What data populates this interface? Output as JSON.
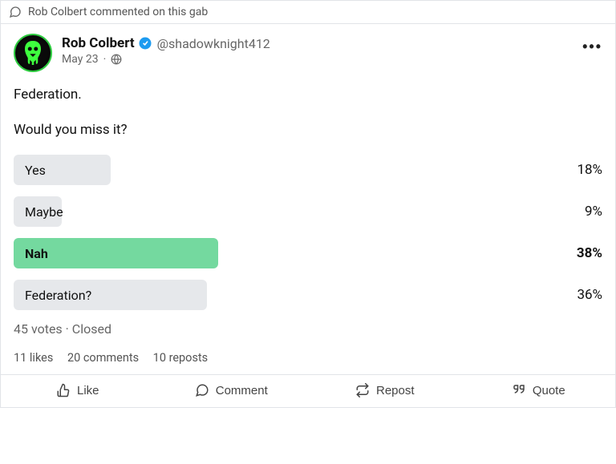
{
  "notice": {
    "text": "Rob Colbert commented on this gab"
  },
  "author": {
    "display_name": "Rob Colbert",
    "handle": "@shadowknight412",
    "date": "May 23"
  },
  "post": {
    "line1": "Federation.",
    "line2": "Would you miss it?"
  },
  "poll": {
    "options": [
      {
        "label": "Yes",
        "pct": "18%",
        "width": 18,
        "leading": false
      },
      {
        "label": "Maybe",
        "pct": "9%",
        "width": 9,
        "leading": false
      },
      {
        "label": "Nah",
        "pct": "38%",
        "width": 38,
        "leading": true
      },
      {
        "label": "Federation?",
        "pct": "36%",
        "width": 36,
        "leading": false
      }
    ],
    "meta": "45 votes · Closed"
  },
  "stats": {
    "likes": "11 likes",
    "comments": "20 comments",
    "reposts": "10 reposts"
  },
  "actions": {
    "like": "Like",
    "comment": "Comment",
    "repost": "Repost",
    "quote": "Quote"
  },
  "chart_data": {
    "type": "bar",
    "title": "Poll: Would you miss Federation?",
    "categories": [
      "Yes",
      "Maybe",
      "Nah",
      "Federation?"
    ],
    "values": [
      18,
      9,
      38,
      36
    ],
    "xlabel": "",
    "ylabel": "Percent",
    "ylim": [
      0,
      100
    ]
  }
}
